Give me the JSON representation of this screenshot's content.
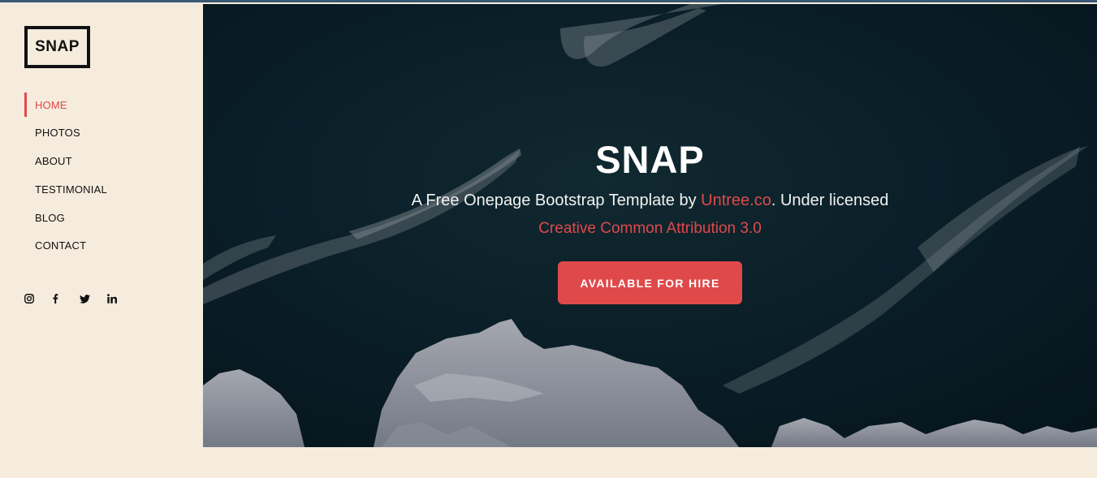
{
  "logo": {
    "text": "SNAP"
  },
  "nav": {
    "items": [
      {
        "label": "HOME",
        "active": true
      },
      {
        "label": "PHOTOS",
        "active": false
      },
      {
        "label": "ABOUT",
        "active": false
      },
      {
        "label": "TESTIMONIAL",
        "active": false
      },
      {
        "label": "BLOG",
        "active": false
      },
      {
        "label": "CONTACT",
        "active": false
      }
    ]
  },
  "social": {
    "icons": [
      "instagram-icon",
      "facebook-icon",
      "twitter-icon",
      "linkedin-icon"
    ]
  },
  "hero": {
    "title": "SNAP",
    "subtitle_prefix": "A Free Onepage Bootstrap Template by ",
    "subtitle_link": "Untree.co",
    "subtitle_suffix": ". Under licensed",
    "license_link": "Creative Common Attribution 3.0",
    "cta_label": "AVAILABLE FOR HIRE"
  },
  "colors": {
    "accent": "#e0494a",
    "sidebar_bg": "#f5ecdd",
    "text_dark": "#111111"
  }
}
